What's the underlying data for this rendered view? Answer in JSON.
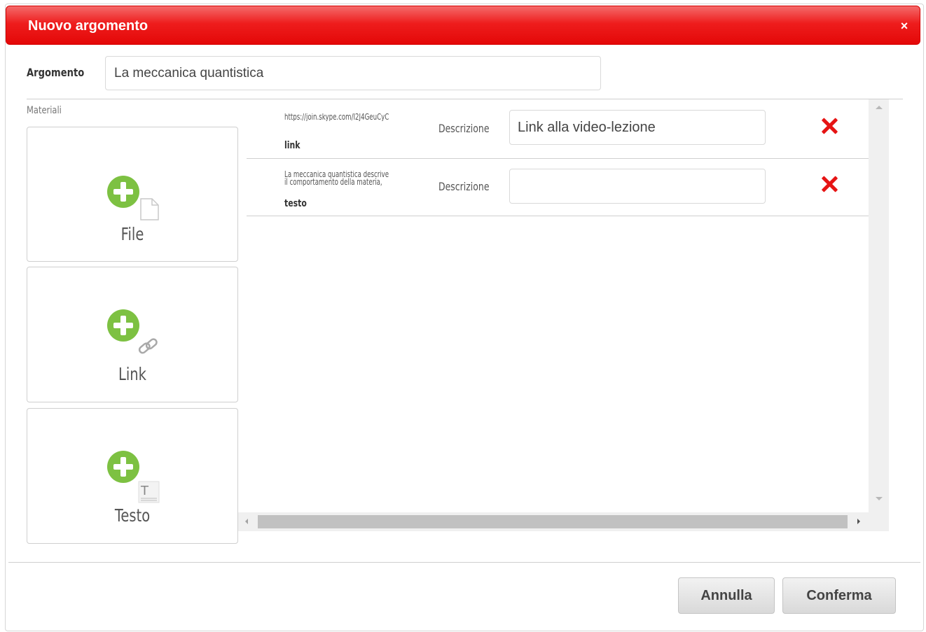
{
  "dialog": {
    "title": "Nuovo argomento",
    "close_label": "×"
  },
  "argomento": {
    "label": "Argomento",
    "value": "La meccanica quantistica"
  },
  "materiali": {
    "label": "Materiali",
    "cards": [
      {
        "label": "File",
        "icon": "add-file-icon"
      },
      {
        "label": "Link",
        "icon": "add-link-icon"
      },
      {
        "label": "Testo",
        "icon": "add-text-icon"
      }
    ],
    "items": [
      {
        "source": "https://join.skype.com/I2J4GeuCyC",
        "type": "link",
        "desc_label": "Descrizione",
        "desc_value": "Link alla video-lezione"
      },
      {
        "source_line1": "La meccanica quantistica descrive",
        "source_line2": "il comportamento della materia,",
        "type": "testo",
        "desc_label": "Descrizione",
        "desc_value": ""
      }
    ]
  },
  "footer": {
    "cancel_label": "Annulla",
    "confirm_label": "Conferma"
  },
  "colors": {
    "titlebar": "#e40808",
    "add_icon": "#7dc142",
    "delete_icon": "#e61414"
  }
}
